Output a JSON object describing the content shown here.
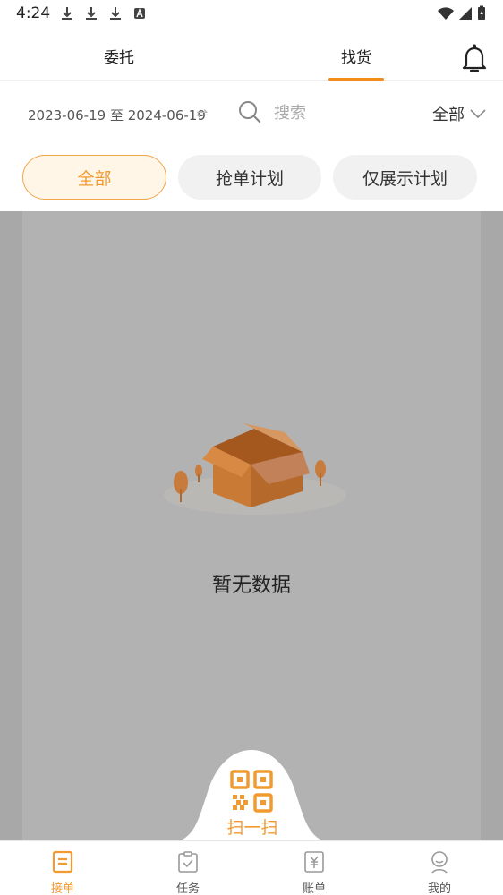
{
  "status_bar": {
    "time": "4:24"
  },
  "header": {
    "tabs": [
      {
        "label": "委托"
      },
      {
        "label": "找货"
      }
    ],
    "active_tab": "找货"
  },
  "filter": {
    "date_range": "2023-06-19 至 2024-06-19",
    "search_placeholder": "搜索",
    "select_value": "全部"
  },
  "chips": [
    {
      "label": "全部"
    },
    {
      "label": "抢单计划"
    },
    {
      "label": "仅展示计划"
    }
  ],
  "empty_state": {
    "text": "暂无数据"
  },
  "scan": {
    "label": "扫一扫"
  },
  "bottom_nav": [
    {
      "label": "接单"
    },
    {
      "label": "任务"
    },
    {
      "label": "账单"
    },
    {
      "label": "我的"
    }
  ],
  "colors": {
    "accent": "#f29a30",
    "overlay": "#a8a8a8"
  }
}
